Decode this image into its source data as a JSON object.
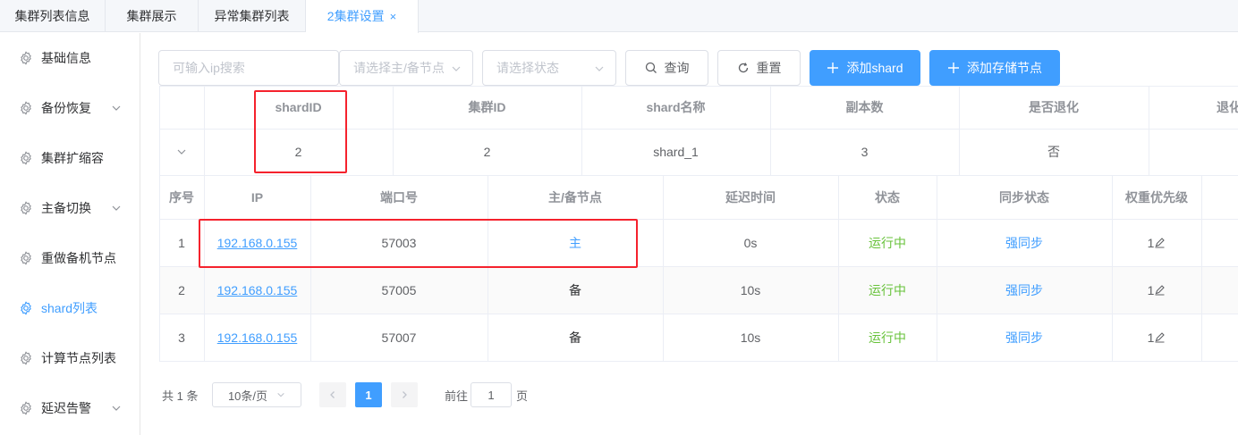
{
  "tabs": [
    {
      "label": "集群列表信息"
    },
    {
      "label": "集群展示"
    },
    {
      "label": "异常集群列表"
    },
    {
      "label": "2集群设置",
      "close": "×"
    }
  ],
  "sidebar": {
    "items": [
      {
        "label": "基础信息"
      },
      {
        "label": "备份恢复"
      },
      {
        "label": "集群扩缩容"
      },
      {
        "label": "主备切换"
      },
      {
        "label": "重做备机节点"
      },
      {
        "label": "shard列表"
      },
      {
        "label": "计算节点列表"
      },
      {
        "label": "延迟告警"
      }
    ]
  },
  "toolbar": {
    "search_placeholder": "可输入ip搜索",
    "role_placeholder": "请选择主/备节点",
    "status_placeholder": "请选择状态",
    "query_label": "查询",
    "reset_label": "重置",
    "add_shard_label": "添加shard",
    "add_storage_label": "添加存储节点"
  },
  "shard_table": {
    "headers": [
      "shardID",
      "集群ID",
      "shard名称",
      "副本数",
      "是否退化",
      "退化"
    ],
    "row": [
      "2",
      "2",
      "shard_1",
      "3",
      "否"
    ]
  },
  "node_table": {
    "headers": [
      "序号",
      "IP",
      "端口号",
      "主/备节点",
      "延迟时间",
      "状态",
      "同步状态",
      "权重优先级"
    ],
    "rows": [
      {
        "no": "1",
        "ip": "192.168.0.155",
        "port": "57003",
        "role": "主",
        "delay": "0s",
        "status": "运行中",
        "sync": "强同步",
        "weight": "1"
      },
      {
        "no": "2",
        "ip": "192.168.0.155",
        "port": "57005",
        "role": "备",
        "delay": "10s",
        "status": "运行中",
        "sync": "强同步",
        "weight": "1"
      },
      {
        "no": "3",
        "ip": "192.168.0.155",
        "port": "57007",
        "role": "备",
        "delay": "10s",
        "status": "运行中",
        "sync": "强同步",
        "weight": "1"
      }
    ]
  },
  "pagination": {
    "total": "共 1 条",
    "page_size": "10条/页",
    "current": "1",
    "goto_prefix": "前往",
    "goto_value": "1",
    "goto_suffix": "页"
  },
  "colors": {
    "accent": "#409eff",
    "success": "#67c23a",
    "highlight": "#f5222d"
  }
}
